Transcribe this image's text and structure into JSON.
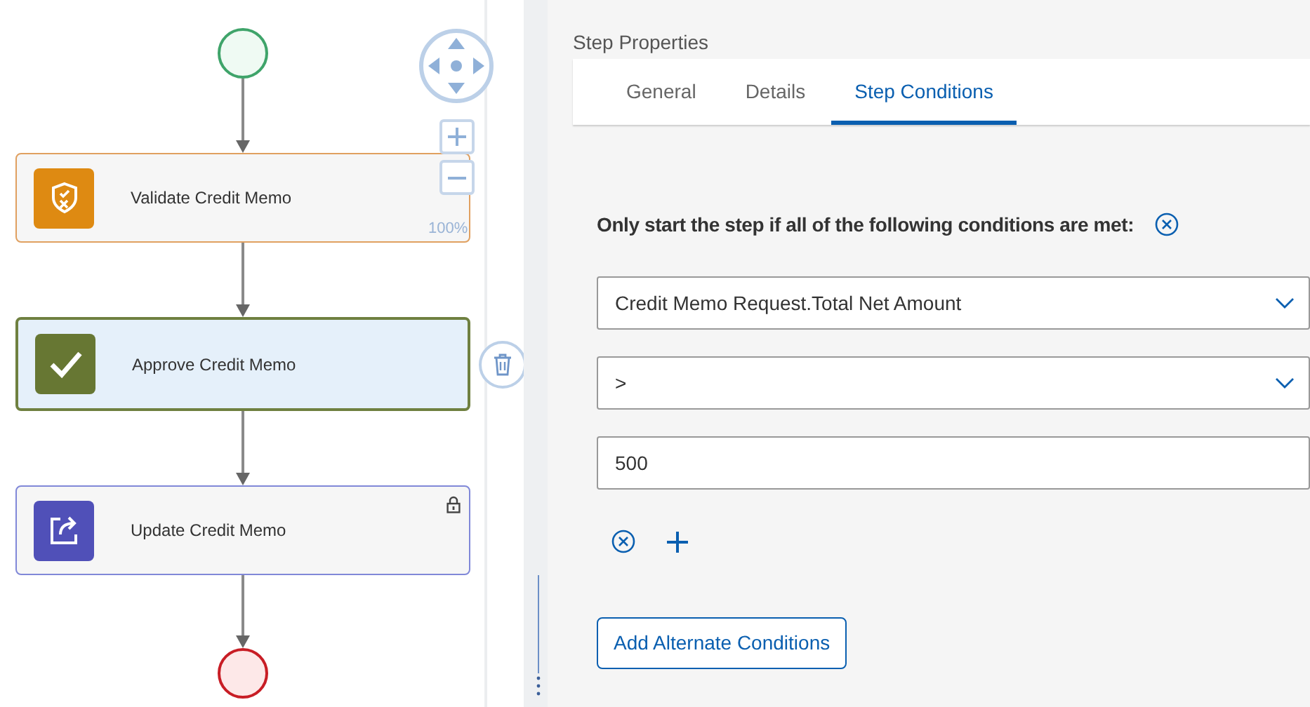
{
  "flow": {
    "zoom_label": "100%",
    "steps": [
      {
        "kind": "validate",
        "label": "Validate Credit Memo",
        "selected": false,
        "locked": false
      },
      {
        "kind": "approve",
        "label": "Approve Credit Memo",
        "selected": true,
        "locked": false
      },
      {
        "kind": "update",
        "label": "Update Credit Memo",
        "selected": false,
        "locked": true
      }
    ]
  },
  "panel": {
    "title": "Step Properties",
    "tabs": [
      {
        "label": "General",
        "selected": false
      },
      {
        "label": "Details",
        "selected": false
      },
      {
        "label": "Step Conditions",
        "selected": true
      }
    ],
    "condition_heading": "Only start the step if all of the following conditions are met:",
    "fields": [
      {
        "kind": "dropdown",
        "value": "Credit Memo Request.Total Net Amount"
      },
      {
        "kind": "dropdown",
        "value": ">"
      },
      {
        "kind": "input",
        "value": "500"
      }
    ],
    "alternate_button": "Add Alternate Conditions"
  }
}
